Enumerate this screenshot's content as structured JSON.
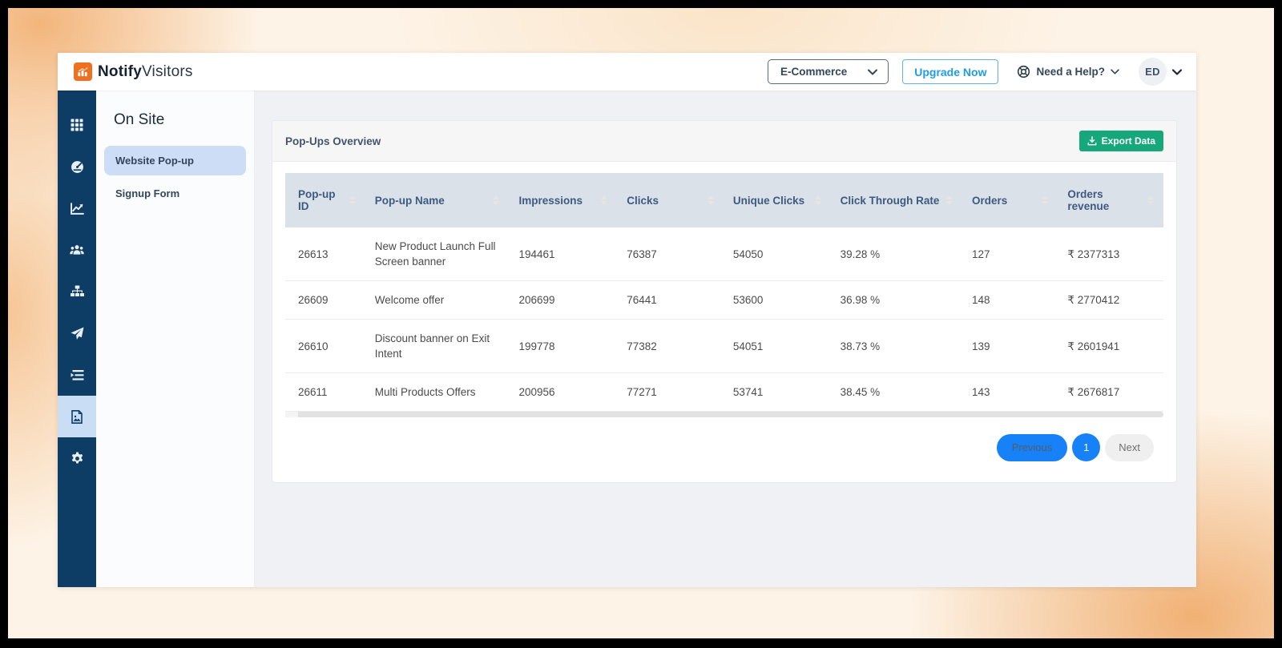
{
  "brand": {
    "bold": "Notify",
    "light": "Visitors",
    "logo_icon": "bar-chart-icon",
    "logo_color": "#f07022"
  },
  "header": {
    "workspace": "E-Commerce",
    "upgrade": "Upgrade Now",
    "help": "Need a Help?",
    "help_icon": "lifebuoy-icon",
    "avatar_initials": "ED"
  },
  "sidebar": {
    "icons": [
      "grid-icon",
      "dashboard-icon",
      "chart-line-icon",
      "users-icon",
      "sitemap-icon",
      "paper-plane-icon",
      "stream-icon",
      "image-icon",
      "gear-icon"
    ],
    "active_index": 7,
    "bg_color": "#0d3c64",
    "active_bg_color": "#c9ddf5"
  },
  "subnav": {
    "title": "On Site",
    "items": [
      {
        "label": "Website Pop-up",
        "active": true
      },
      {
        "label": "Signup Form",
        "active": false
      }
    ]
  },
  "main": {
    "card_title": "Pop-Ups Overview",
    "export_label": "Export Data",
    "export_icon": "download-icon",
    "export_color": "#16a77b",
    "table": {
      "columns": [
        "Pop-up ID",
        "Pop-up Name",
        "Impressions",
        "Clicks",
        "Unique Clicks",
        "Click Through Rate",
        "Orders",
        "Orders revenue"
      ],
      "rows": [
        {
          "id": "26613",
          "name": "New Product Launch Full Screen banner",
          "impressions": "194461",
          "clicks": "76387",
          "unique_clicks": "54050",
          "ctr": "39.28 %",
          "orders": "127",
          "revenue": "₹ 2377313"
        },
        {
          "id": "26609",
          "name": "Welcome offer",
          "impressions": "206699",
          "clicks": "76441",
          "unique_clicks": "53600",
          "ctr": "36.98 %",
          "orders": "148",
          "revenue": "₹ 2770412"
        },
        {
          "id": "26610",
          "name": "Discount banner on Exit Intent",
          "impressions": "199778",
          "clicks": "77382",
          "unique_clicks": "54051",
          "ctr": "38.73 %",
          "orders": "139",
          "revenue": "₹ 2601941"
        },
        {
          "id": "26611",
          "name": "Multi Products Offers",
          "impressions": "200956",
          "clicks": "77271",
          "unique_clicks": "53741",
          "ctr": "38.45 %",
          "orders": "143",
          "revenue": "₹ 2676817"
        }
      ]
    },
    "pagination": {
      "previous": "Previous",
      "current": "1",
      "next": "Next",
      "accent_color": "#1781f8"
    }
  }
}
